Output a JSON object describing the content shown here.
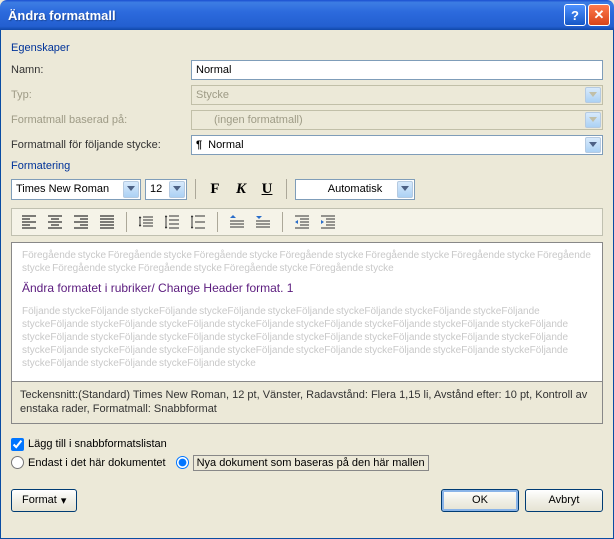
{
  "title": "Ändra formatmall",
  "sections": {
    "properties": "Egenskaper",
    "formatting": "Formatering"
  },
  "labels": {
    "name": "Namn:",
    "type": "Typ:",
    "basedOn": "Formatmall baserad på:",
    "nextStyle": "Formatmall för följande stycke:"
  },
  "values": {
    "name": "Normal",
    "type": "Stycke",
    "basedOn": "(ingen formatmall)",
    "nextStyle": "Normal"
  },
  "format": {
    "font": "Times New Roman",
    "size": "12",
    "color": "Automatisk"
  },
  "preview": {
    "before": "Föregående stycke Föregående stycke Föregående stycke Föregående stycke Föregående stycke Föregående stycke Föregående stycke Föregående stycke Föregående stycke Föregående stycke Föregående stycke",
    "sample": "Ändra formatet i rubriker/ Change Header format.     1",
    "after": "Följande styckeFöljande styckeFöljande styckeFöljande styckeFöljande styckeFöljande styckeFöljande styckeFöljande styckeFöljande styckeFöljande styckeFöljande styckeFöljande styckeFöljande styckeFöljande styckeFöljande styckeFöljande styckeFöljande styckeFöljande styckeFöljande styckeFöljande styckeFöljande styckeFöljande styckeFöljande styckeFöljande styckeFöljande styckeFöljande styckeFöljande styckeFöljande styckeFöljande styckeFöljande styckeFöljande styckeFöljande styckeFöljande styckeFöljande styckeFöljande stycke"
  },
  "description": "Teckensnitt:(Standard) Times New Roman, 12 pt, Vänster, Radavstånd:  Flera 1,15 li, Avstånd efter:  10 pt, Kontroll av enstaka rader, Formatmall: Snabbformat",
  "options": {
    "quickList": "Lägg till i snabbformatslistan",
    "thisDoc": "Endast i det här dokumentet",
    "newDocs": "Nya dokument som baseras på den här mallen"
  },
  "buttons": {
    "format": "Format",
    "ok": "OK",
    "cancel": "Avbryt"
  }
}
